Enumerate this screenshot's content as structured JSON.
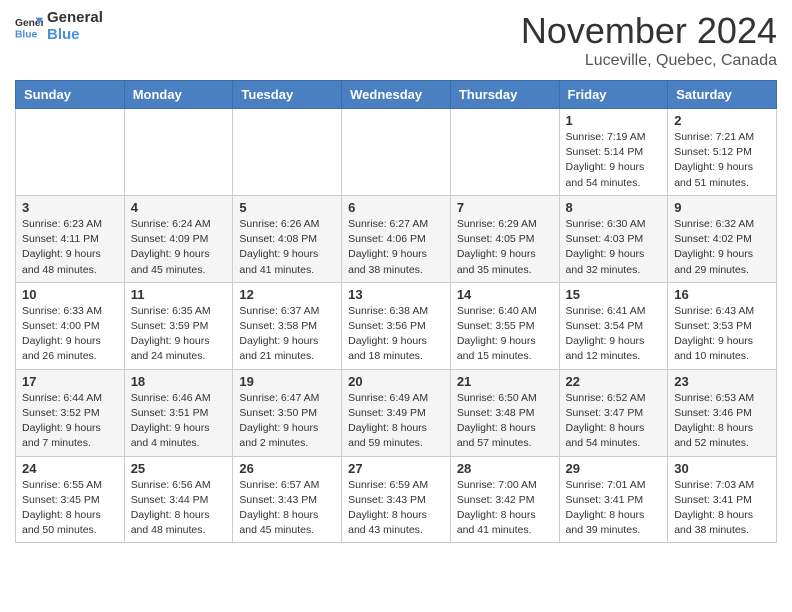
{
  "header": {
    "logo_line1": "General",
    "logo_line2": "Blue",
    "month": "November 2024",
    "location": "Luceville, Quebec, Canada"
  },
  "weekdays": [
    "Sunday",
    "Monday",
    "Tuesday",
    "Wednesday",
    "Thursday",
    "Friday",
    "Saturday"
  ],
  "weeks": [
    [
      {
        "day": "",
        "info": ""
      },
      {
        "day": "",
        "info": ""
      },
      {
        "day": "",
        "info": ""
      },
      {
        "day": "",
        "info": ""
      },
      {
        "day": "",
        "info": ""
      },
      {
        "day": "1",
        "info": "Sunrise: 7:19 AM\nSunset: 5:14 PM\nDaylight: 9 hours\nand 54 minutes."
      },
      {
        "day": "2",
        "info": "Sunrise: 7:21 AM\nSunset: 5:12 PM\nDaylight: 9 hours\nand 51 minutes."
      }
    ],
    [
      {
        "day": "3",
        "info": "Sunrise: 6:23 AM\nSunset: 4:11 PM\nDaylight: 9 hours\nand 48 minutes."
      },
      {
        "day": "4",
        "info": "Sunrise: 6:24 AM\nSunset: 4:09 PM\nDaylight: 9 hours\nand 45 minutes."
      },
      {
        "day": "5",
        "info": "Sunrise: 6:26 AM\nSunset: 4:08 PM\nDaylight: 9 hours\nand 41 minutes."
      },
      {
        "day": "6",
        "info": "Sunrise: 6:27 AM\nSunset: 4:06 PM\nDaylight: 9 hours\nand 38 minutes."
      },
      {
        "day": "7",
        "info": "Sunrise: 6:29 AM\nSunset: 4:05 PM\nDaylight: 9 hours\nand 35 minutes."
      },
      {
        "day": "8",
        "info": "Sunrise: 6:30 AM\nSunset: 4:03 PM\nDaylight: 9 hours\nand 32 minutes."
      },
      {
        "day": "9",
        "info": "Sunrise: 6:32 AM\nSunset: 4:02 PM\nDaylight: 9 hours\nand 29 minutes."
      }
    ],
    [
      {
        "day": "10",
        "info": "Sunrise: 6:33 AM\nSunset: 4:00 PM\nDaylight: 9 hours\nand 26 minutes."
      },
      {
        "day": "11",
        "info": "Sunrise: 6:35 AM\nSunset: 3:59 PM\nDaylight: 9 hours\nand 24 minutes."
      },
      {
        "day": "12",
        "info": "Sunrise: 6:37 AM\nSunset: 3:58 PM\nDaylight: 9 hours\nand 21 minutes."
      },
      {
        "day": "13",
        "info": "Sunrise: 6:38 AM\nSunset: 3:56 PM\nDaylight: 9 hours\nand 18 minutes."
      },
      {
        "day": "14",
        "info": "Sunrise: 6:40 AM\nSunset: 3:55 PM\nDaylight: 9 hours\nand 15 minutes."
      },
      {
        "day": "15",
        "info": "Sunrise: 6:41 AM\nSunset: 3:54 PM\nDaylight: 9 hours\nand 12 minutes."
      },
      {
        "day": "16",
        "info": "Sunrise: 6:43 AM\nSunset: 3:53 PM\nDaylight: 9 hours\nand 10 minutes."
      }
    ],
    [
      {
        "day": "17",
        "info": "Sunrise: 6:44 AM\nSunset: 3:52 PM\nDaylight: 9 hours\nand 7 minutes."
      },
      {
        "day": "18",
        "info": "Sunrise: 6:46 AM\nSunset: 3:51 PM\nDaylight: 9 hours\nand 4 minutes."
      },
      {
        "day": "19",
        "info": "Sunrise: 6:47 AM\nSunset: 3:50 PM\nDaylight: 9 hours\nand 2 minutes."
      },
      {
        "day": "20",
        "info": "Sunrise: 6:49 AM\nSunset: 3:49 PM\nDaylight: 8 hours\nand 59 minutes."
      },
      {
        "day": "21",
        "info": "Sunrise: 6:50 AM\nSunset: 3:48 PM\nDaylight: 8 hours\nand 57 minutes."
      },
      {
        "day": "22",
        "info": "Sunrise: 6:52 AM\nSunset: 3:47 PM\nDaylight: 8 hours\nand 54 minutes."
      },
      {
        "day": "23",
        "info": "Sunrise: 6:53 AM\nSunset: 3:46 PM\nDaylight: 8 hours\nand 52 minutes."
      }
    ],
    [
      {
        "day": "24",
        "info": "Sunrise: 6:55 AM\nSunset: 3:45 PM\nDaylight: 8 hours\nand 50 minutes."
      },
      {
        "day": "25",
        "info": "Sunrise: 6:56 AM\nSunset: 3:44 PM\nDaylight: 8 hours\nand 48 minutes."
      },
      {
        "day": "26",
        "info": "Sunrise: 6:57 AM\nSunset: 3:43 PM\nDaylight: 8 hours\nand 45 minutes."
      },
      {
        "day": "27",
        "info": "Sunrise: 6:59 AM\nSunset: 3:43 PM\nDaylight: 8 hours\nand 43 minutes."
      },
      {
        "day": "28",
        "info": "Sunrise: 7:00 AM\nSunset: 3:42 PM\nDaylight: 8 hours\nand 41 minutes."
      },
      {
        "day": "29",
        "info": "Sunrise: 7:01 AM\nSunset: 3:41 PM\nDaylight: 8 hours\nand 39 minutes."
      },
      {
        "day": "30",
        "info": "Sunrise: 7:03 AM\nSunset: 3:41 PM\nDaylight: 8 hours\nand 38 minutes."
      }
    ]
  ]
}
